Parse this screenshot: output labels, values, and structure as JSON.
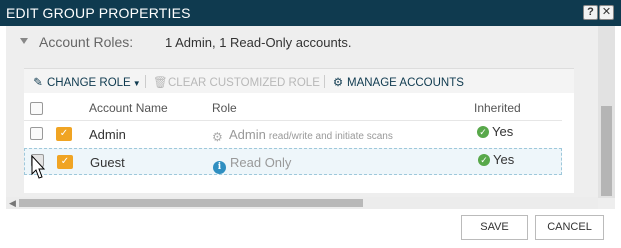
{
  "dialog": {
    "title": "EDIT GROUP PROPERTIES",
    "help_glyph": "?",
    "close_glyph": "✕"
  },
  "section": {
    "label": "Account Roles:",
    "summary": "1 Admin, 1 Read-Only accounts."
  },
  "toolbar": {
    "change_role": "CHANGE ROLE",
    "clear_customized_role": "CLEAR CUSTOMIZED ROLE",
    "manage_accounts": "MANAGE ACCOUNTS"
  },
  "grid": {
    "columns": [
      "",
      "Account Name",
      "Role",
      "Inherited"
    ],
    "rows": [
      {
        "name": "Admin",
        "role": "Admin",
        "role_detail": "read/write and initiate scans",
        "role_icon": "gear-icon",
        "inherited": "Yes",
        "checked": false
      },
      {
        "name": "Guest",
        "role": "Read Only",
        "role_detail": "",
        "role_icon": "info-icon",
        "inherited": "Yes",
        "checked": true
      }
    ]
  },
  "buttons": {
    "save": "SAVE",
    "cancel": "CANCEL"
  },
  "colors": {
    "titlebar": "#0f3a4f",
    "accent": "#0f3a4f",
    "role_icon": "#f0a423",
    "inherited_check": "#58a84a",
    "info_icon": "#2f8fc1",
    "selected_row": "#eef6fa"
  }
}
